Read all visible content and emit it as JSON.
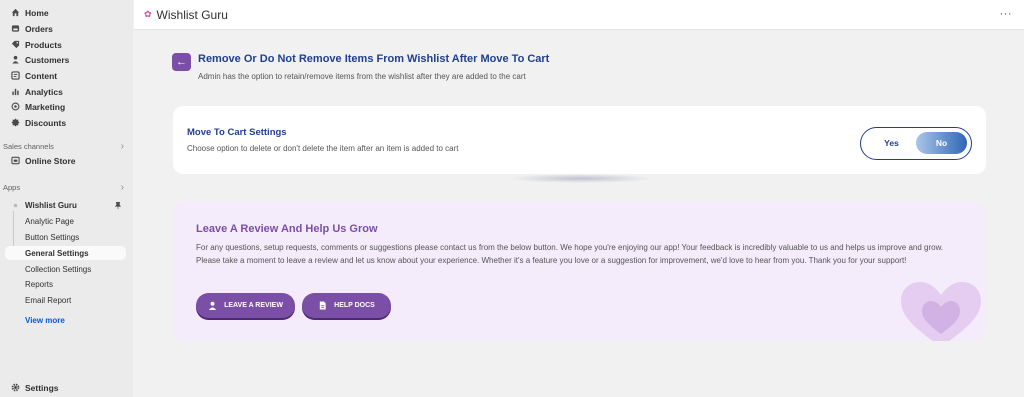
{
  "sidebar": {
    "nav": [
      {
        "label": "Home",
        "icon": "home-icon"
      },
      {
        "label": "Orders",
        "icon": "orders-icon"
      },
      {
        "label": "Products",
        "icon": "tag-icon"
      },
      {
        "label": "Customers",
        "icon": "person-icon"
      },
      {
        "label": "Content",
        "icon": "content-icon"
      },
      {
        "label": "Analytics",
        "icon": "bar-chart-icon"
      },
      {
        "label": "Marketing",
        "icon": "target-icon"
      },
      {
        "label": "Discounts",
        "icon": "discount-icon"
      }
    ],
    "sales_channels_label": "Sales channels",
    "online_store": "Online Store",
    "apps_label": "Apps",
    "app_name": "Wishlist Guru",
    "app_sub_items": [
      "Analytic Page",
      "Button Settings",
      "General Settings",
      "Collection Settings",
      "Reports",
      "Email Report"
    ],
    "active_item": "General Settings",
    "view_more": "View more",
    "settings": "Settings"
  },
  "topbar": {
    "title": "Wishlist Guru",
    "more": "···"
  },
  "header": {
    "title": "Remove Or Do Not Remove Items From Wishlist After Move To Cart",
    "subtitle": "Admin has the option to retain/remove items from the wishlist after they are added to the cart"
  },
  "settings_card": {
    "title": "Move To Cart Settings",
    "description": "Choose option to delete or don't delete the item after an item is added to cart",
    "option_yes": "Yes",
    "option_no": "No",
    "selected": "No"
  },
  "review": {
    "title": "Leave A Review And Help Us Grow",
    "body": "For any questions, setup requests, comments or suggestions please contact us from the below button. We hope you're enjoying our app! Your feedback is incredibly valuable to us and helps us improve and grow. Please take a moment to leave a review and let us know about your experience. Whether it's a feature you love or a suggestion for improvement, we'd love to hear from you. Thank you for your support!",
    "leave_review_button": "LEAVE A REVIEW",
    "help_docs_button": "HELP DOCS"
  },
  "colors": {
    "accent_purple": "#7b4fa6",
    "heading_blue": "#1f3f8f",
    "link_blue": "#005bd3"
  }
}
